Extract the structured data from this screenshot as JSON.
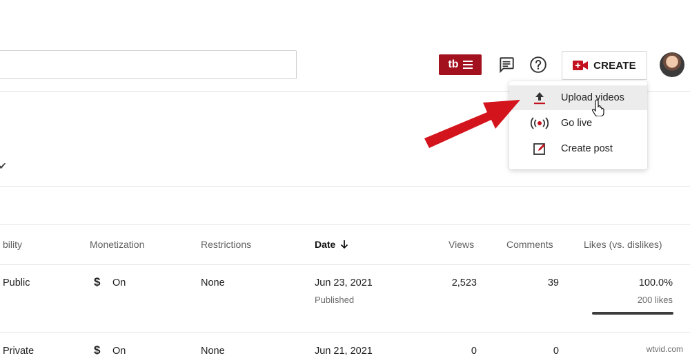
{
  "header": {
    "tubebuddy_label": "tb",
    "create_label": "CREATE"
  },
  "create_menu": {
    "items": [
      {
        "label": "Upload videos",
        "icon": "upload-icon"
      },
      {
        "label": "Go live",
        "icon": "live-broadcast-icon"
      },
      {
        "label": "Create post",
        "icon": "edit-post-icon"
      }
    ]
  },
  "filter": {
    "check": "✔"
  },
  "table": {
    "headers": {
      "visibility": "bility",
      "monetization": "Monetization",
      "restrictions": "Restrictions",
      "date": "Date",
      "views": "Views",
      "comments": "Comments",
      "likes": "Likes (vs. dislikes)"
    },
    "rows": [
      {
        "visibility": "Public",
        "monetization": "On",
        "monetization_icon": "$",
        "restrictions": "None",
        "date": "Jun 23, 2021",
        "status": "Published",
        "views": "2,523",
        "comments": "39",
        "likes_pct": "100.0%",
        "likes_count": "200 likes",
        "likes_ratio": 1.0
      },
      {
        "visibility": "Private",
        "monetization": "On",
        "monetization_icon": "$",
        "restrictions": "None",
        "date": "Jun 21, 2021",
        "status": "",
        "views": "0",
        "comments": "0",
        "likes_pct": "",
        "likes_count": "",
        "likes_ratio": null
      }
    ]
  },
  "watermark": "wtvid.com",
  "colors": {
    "accent_red": "#a3101e",
    "arrow_red": "#d4141c"
  }
}
